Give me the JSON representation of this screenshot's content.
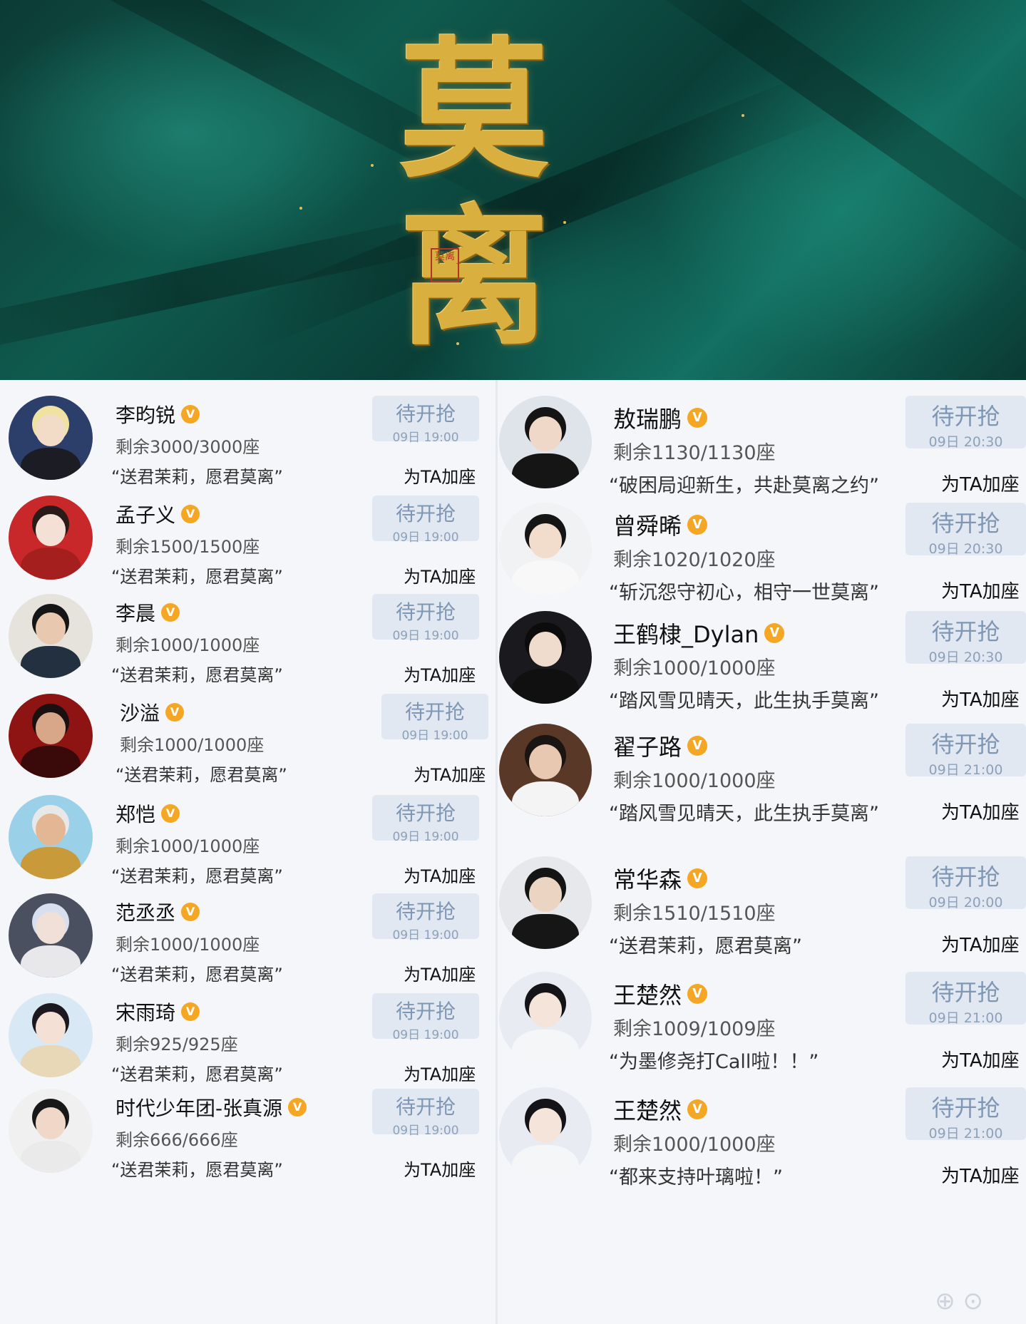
{
  "banner": {
    "title_char_1": "莫",
    "title_char_2": "离",
    "seal_text": "莫离"
  },
  "common": {
    "rush_label": "待开抢",
    "add_label": "为TA加座"
  },
  "left": [
    {
      "name": "李昀锐",
      "remain": "剩余3000/3000座",
      "quote": "“送君茉莉，愿君莫离”",
      "time": "09日 19:00",
      "avatar": {
        "bg": "#2c3e6a",
        "skin": "#f2dcc8",
        "hair": "#f0e2a0",
        "cloth": "#1c1c24"
      }
    },
    {
      "name": "孟子义",
      "remain": "剩余1500/1500座",
      "quote": "“送君茉莉，愿君莫离”",
      "time": "09日 19:00",
      "avatar": {
        "bg": "#c8282a",
        "skin": "#f5e0d6",
        "hair": "#2a1a18",
        "cloth": "#a51f1f"
      }
    },
    {
      "name": "李晨",
      "remain": "剩余1000/1000座",
      "quote": "“送君茉莉，愿君莫离”",
      "time": "09日 19:00",
      "avatar": {
        "bg": "#e6e2dc",
        "skin": "#e8c8ae",
        "hair": "#151515",
        "cloth": "#223040"
      }
    },
    {
      "name": "沙溢",
      "remain": "剩余1000/1000座",
      "quote": "“送君茉莉，愿君莫离”",
      "time": "09日 19:00",
      "avatar": {
        "bg": "#8e1414",
        "skin": "#d8a78a",
        "hair": "#1a1010",
        "cloth": "#3a0a0a"
      }
    },
    {
      "name": "郑恺",
      "remain": "剩余1000/1000座",
      "quote": "“送君茉莉，愿君莫离”",
      "time": "09日 19:00",
      "avatar": {
        "bg": "#9ad0e8",
        "skin": "#e4b794",
        "hair": "#e8e8e8",
        "cloth": "#c89a3a"
      }
    },
    {
      "name": "范丞丞",
      "remain": "剩余1000/1000座",
      "quote": "“送君茉莉，愿君莫离”",
      "time": "09日 19:00",
      "avatar": {
        "bg": "#4a5060",
        "skin": "#f0e0d8",
        "hair": "#d8e0f0",
        "cloth": "#e8e8ea"
      }
    },
    {
      "name": "宋雨琦",
      "remain": "剩余925/925座",
      "quote": "“送君茉莉，愿君莫离”",
      "time": "09日 19:00",
      "avatar": {
        "bg": "#d8e8f4",
        "skin": "#f4e0d4",
        "hair": "#1c1820",
        "cloth": "#e8d8b8"
      }
    },
    {
      "name": "时代少年团-张真源",
      "remain": "剩余666/666座",
      "quote": "“送君茉莉，愿君莫离”",
      "time": "09日 19:00",
      "avatar": {
        "bg": "#f0f0f0",
        "skin": "#f0d8c8",
        "hair": "#181818",
        "cloth": "#eaeaea"
      }
    }
  ],
  "right": [
    {
      "name": "敖瑞鹏",
      "remain": "剩余1130/1130座",
      "quote": "“破困局迎新生，共赴莫离之约”",
      "time": "09日 20:30",
      "avatar": {
        "bg": "#dfe3ea",
        "skin": "#f0d8c8",
        "hair": "#141414",
        "cloth": "#151515"
      }
    },
    {
      "name": "曾舜晞",
      "remain": "剩余1020/1020座",
      "quote": "“斩沉怨守初心，相守一世莫离”",
      "time": "09日 20:30",
      "avatar": {
        "bg": "#f0f2f4",
        "skin": "#f2dccc",
        "hair": "#151515",
        "cloth": "#f8f8f8"
      }
    },
    {
      "name": "王鹤棣_Dylan",
      "remain": "剩余1000/1000座",
      "quote": "“踏风雪见晴天，此生执手莫离”",
      "time": "09日 20:30",
      "avatar": {
        "bg": "#1a1a1e",
        "skin": "#f0dccc",
        "hair": "#0c0c0c",
        "cloth": "#101010"
      }
    },
    {
      "name": "翟子路",
      "remain": "剩余1000/1000座",
      "quote": "“踏风雪见晴天，此生执手莫离”",
      "time": "09日 21:00",
      "avatar": {
        "bg": "#5a3828",
        "skin": "#e8c8b0",
        "hair": "#1a1412",
        "cloth": "#f4f4f4"
      }
    },
    {
      "name": "常华森",
      "remain": "剩余1510/1510座",
      "quote": "“送君茉莉，愿君莫离”",
      "time": "09日 20:00",
      "avatar": {
        "bg": "#e6e8ec",
        "skin": "#ecd4c2",
        "hair": "#141414",
        "cloth": "#161616"
      }
    },
    {
      "name": "王楚然",
      "remain": "剩余1009/1009座",
      "quote": "“为墨修尧打Call啦！！”",
      "time": "09日 21:00",
      "avatar": {
        "bg": "#e8ecf2",
        "skin": "#f4e4da",
        "hair": "#141418",
        "cloth": "#f4f6f8"
      }
    },
    {
      "name": "王楚然",
      "remain": "剩余1000/1000座",
      "quote": "“都来支持叶璃啦！”",
      "time": "09日 21:00",
      "avatar": {
        "bg": "#e8ecf2",
        "skin": "#f4e4da",
        "hair": "#141418",
        "cloth": "#f4f6f8"
      }
    }
  ]
}
